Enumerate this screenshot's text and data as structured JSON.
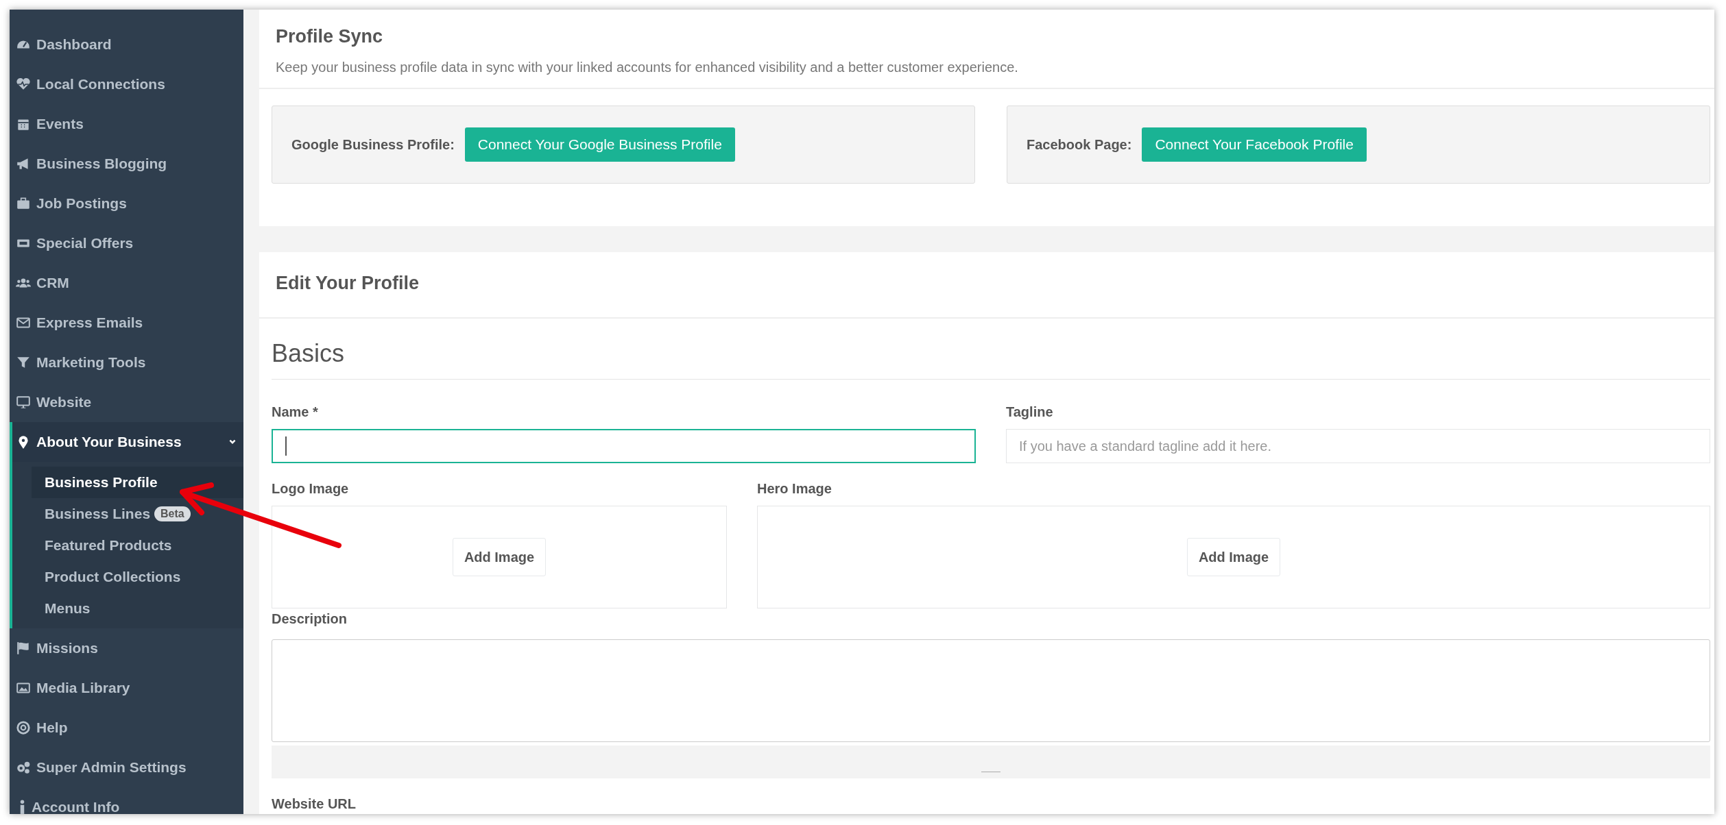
{
  "sidebar": {
    "items": [
      {
        "label": "Dashboard",
        "selected": false
      },
      {
        "label": "Local Connections",
        "selected": false
      },
      {
        "label": "Events",
        "selected": false
      },
      {
        "label": "Business Blogging",
        "selected": false
      },
      {
        "label": "Job Postings",
        "selected": false
      },
      {
        "label": "Special Offers",
        "selected": false
      },
      {
        "label": "CRM",
        "selected": false
      },
      {
        "label": "Express Emails",
        "selected": false
      },
      {
        "label": "Marketing Tools",
        "selected": false
      },
      {
        "label": "Website",
        "selected": false
      },
      {
        "label": "About Your Business",
        "selected": false,
        "expanded": true,
        "children": [
          {
            "label": "Business Profile",
            "selected": true
          },
          {
            "label": "Business Lines",
            "badge": "Beta",
            "selected": false
          },
          {
            "label": "Featured Products",
            "selected": false
          },
          {
            "label": "Product Collections",
            "selected": false
          },
          {
            "label": "Menus",
            "selected": false
          }
        ]
      },
      {
        "label": "Missions",
        "selected": false
      },
      {
        "label": "Media Library",
        "selected": false
      },
      {
        "label": "Help",
        "selected": false
      },
      {
        "label": "Super Admin Settings",
        "selected": false
      },
      {
        "label": "Account Info",
        "selected": false
      }
    ]
  },
  "profile_sync": {
    "title": "Profile Sync",
    "description": "Keep your business profile data in sync with your linked accounts for enhanced visibility and a better customer experience.",
    "accounts": [
      {
        "label": "Google Business Profile:",
        "button": "Connect Your Google Business Profile"
      },
      {
        "label": "Facebook Page:",
        "button": "Connect Your Facebook Profile"
      }
    ]
  },
  "edit_profile": {
    "title": "Edit Your Profile",
    "section": "Basics",
    "rows": [
      [
        {
          "kind": "text",
          "label": "Name *",
          "focused": true
        },
        {
          "kind": "text",
          "label": "Tagline",
          "placeholder": "If you have a standard tagline add it here.",
          "focused": false
        }
      ],
      [
        {
          "kind": "image",
          "label": "Logo Image",
          "button": "Add Image"
        },
        {
          "kind": "image",
          "label": "Hero Image",
          "button": "Add Image"
        }
      ],
      [
        {
          "kind": "textarea",
          "label": "Description"
        }
      ],
      [
        {
          "kind": "text_cut",
          "label": "Website URL"
        }
      ]
    ]
  }
}
